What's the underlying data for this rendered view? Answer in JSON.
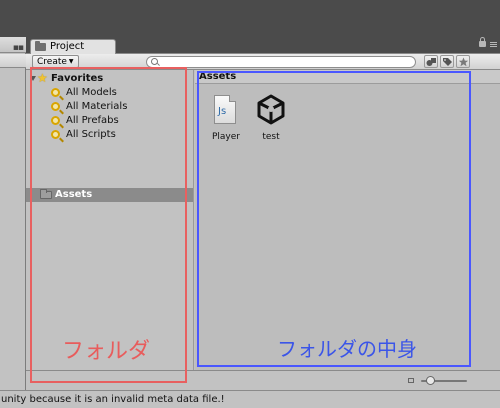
{
  "window": {
    "tab_label": "Project",
    "create_label": "Create",
    "search_placeholder": ""
  },
  "favorites": {
    "label": "Favorites",
    "items": [
      {
        "label": "All Models"
      },
      {
        "label": "All Materials"
      },
      {
        "label": "All Prefabs"
      },
      {
        "label": "All Scripts"
      }
    ]
  },
  "tree": {
    "assets_label": "Assets"
  },
  "content": {
    "breadcrumb": "Assets",
    "assets": [
      {
        "label": "Player",
        "icon": "javascript-file-icon"
      },
      {
        "label": "test",
        "icon": "unity-scene-icon"
      }
    ]
  },
  "footer": {
    "zoom_level": 0.2
  },
  "status_bar": {
    "message": "unity because it is an invalid meta data file.!"
  },
  "annotations": {
    "left_label": "フォルダ",
    "left_color": "#e86060",
    "right_label": "フォルダの中身",
    "right_color": "#4a57ff"
  }
}
